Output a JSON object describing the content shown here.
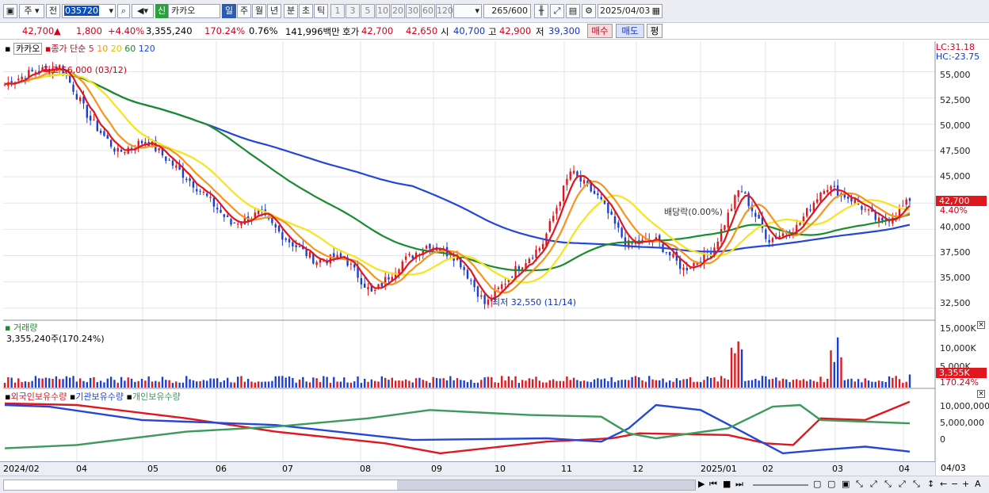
{
  "toolbar": {
    "period_main": "주",
    "prev": "전",
    "code": "035720",
    "badge": "신",
    "name": "카카오",
    "periods": [
      "일",
      "주",
      "월",
      "년",
      "분",
      "초",
      "틱"
    ],
    "numbers": [
      "1",
      "3",
      "5",
      "10",
      "20",
      "30",
      "60",
      "120"
    ],
    "count": "265",
    "count_total": "/600",
    "date": "2025/04/03"
  },
  "quote": {
    "price": "42,700",
    "change": "1,800",
    "change_pct": "+4.40%",
    "volume": "3,355,240",
    "volume_ratio": "170.24%",
    "turnover": "0.76%",
    "amount": "141,996백만",
    "bid_label": "호가",
    "ask": "42,700",
    "bid": "42,650",
    "open_label": "시",
    "open": "40,700",
    "high_label": "고",
    "high": "42,900",
    "low_label": "저",
    "low": "39,300",
    "buy_btn": "매수",
    "sell_btn": "매도",
    "eval_btn": "평"
  },
  "price_panel": {
    "legend_name": "카카오",
    "legend_series": "종가 단순",
    "ma_periods": [
      "5",
      "10",
      "20",
      "60",
      "120"
    ],
    "max_label": "최고 56,000 (03/12)",
    "min_label": "최저 32,550 (11/14)",
    "dividend_label": "배당락(0.00%)",
    "lc": "LC:31.18",
    "hc": "HC:-23.75",
    "current_tag": "42,700",
    "current_pct": "4.40%"
  },
  "volume_panel": {
    "title": "거래량",
    "value": "3,355,240주(170.24%)",
    "current_tag": "3,355K",
    "current_pct": "170.24%"
  },
  "holder_panel": {
    "legend": [
      "외국인보유수량",
      "기관보유수량",
      "개인보유수량"
    ]
  },
  "axis": {
    "price_ticks": [
      "55,000",
      "52,500",
      "50,000",
      "47,500",
      "45,000",
      "42,500",
      "40,000",
      "37,500",
      "35,000",
      "32,500"
    ],
    "volume_ticks": [
      "15,000K",
      "10,000K",
      "5,000K"
    ],
    "holder_ticks": [
      "10,000,000",
      "5,000,000",
      "0"
    ],
    "x_labels": [
      "2024/02",
      "04",
      "05",
      "06",
      "07",
      "08",
      "09",
      "10",
      "11",
      "12",
      "2025/01",
      "02",
      "03",
      "04"
    ],
    "x_last": "04/03"
  },
  "colors": {
    "ma5": "#e0171f",
    "ma10": "#f7941d",
    "ma20": "#f6e51d",
    "ma60": "#1a8c2e",
    "ma120": "#2447d6",
    "up": "#e0171f",
    "down": "#1c3ed0",
    "foreign": "#e0171f",
    "inst": "#2447d6",
    "retail": "#3d9a5a"
  },
  "chart_data": {
    "type": "candlestick",
    "title": "카카오",
    "y_range": [
      31500,
      57000
    ],
    "close_keypoints": [
      {
        "x": "2024/02",
        "y": 53800
      },
      {
        "x": "2024/03",
        "y": 55000
      },
      {
        "x": "2024/03/12",
        "y": 55500
      },
      {
        "x": "2024/04",
        "y": 50500
      },
      {
        "x": "2024/04/20",
        "y": 47300
      },
      {
        "x": "2024/05",
        "y": 48500
      },
      {
        "x": "2024/05/20",
        "y": 46000
      },
      {
        "x": "2024/06",
        "y": 43500
      },
      {
        "x": "2024/07",
        "y": 40500
      },
      {
        "x": "2024/07/15",
        "y": 41500
      },
      {
        "x": "2024/08",
        "y": 39000
      },
      {
        "x": "2024/08/20",
        "y": 37000
      },
      {
        "x": "2024/09",
        "y": 37300
      },
      {
        "x": "2024/09/10",
        "y": 33800
      },
      {
        "x": "2024/10",
        "y": 36800
      },
      {
        "x": "2024/10/25",
        "y": 38600
      },
      {
        "x": "2024/11",
        "y": 37300
      },
      {
        "x": "2024/11/14",
        "y": 32800
      },
      {
        "x": "2024/11/28",
        "y": 36000
      },
      {
        "x": "2024/12",
        "y": 38500
      },
      {
        "x": "2024/12/09",
        "y": 45500
      },
      {
        "x": "2024/12/20",
        "y": 43000
      },
      {
        "x": "2024/12/30",
        "y": 38500
      },
      {
        "x": "2025/01",
        "y": 39000
      },
      {
        "x": "2025/01/20",
        "y": 36200
      },
      {
        "x": "2025/02",
        "y": 37800
      },
      {
        "x": "2025/02/06",
        "y": 44000
      },
      {
        "x": "2025/02/20",
        "y": 39000
      },
      {
        "x": "2025/03",
        "y": 40200
      },
      {
        "x": "2025/03/10",
        "y": 44200
      },
      {
        "x": "2025/03/25",
        "y": 42800
      },
      {
        "x": "2025/04/01",
        "y": 40500
      },
      {
        "x": "2025/04/03",
        "y": 42700
      }
    ]
  }
}
